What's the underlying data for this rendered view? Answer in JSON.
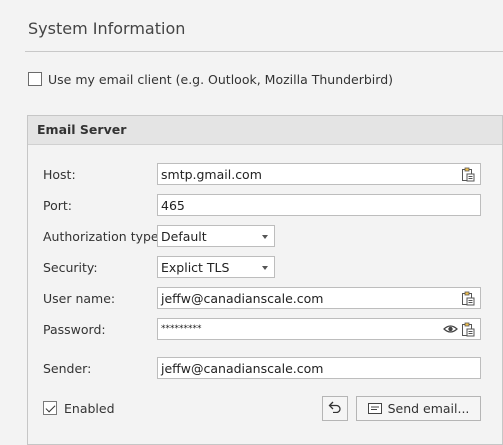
{
  "section_title": "System Information",
  "use_email_client": {
    "label": "Use my email client (e.g. Outlook, Mozilla Thunderbird)",
    "checked": false
  },
  "email_server": {
    "header": "Email Server",
    "host": {
      "label": "Host:",
      "value": "smtp.gmail.com",
      "icon": "clipboard-icon"
    },
    "port": {
      "label": "Port:",
      "value": "465"
    },
    "auth": {
      "label": "Authorization type:",
      "value": "Default"
    },
    "security": {
      "label": "Security:",
      "value": "Explict TLS"
    },
    "username": {
      "label": "User name:",
      "value": "jeffw@canadianscale.com",
      "icon": "clipboard-icon"
    },
    "password": {
      "label": "Password:",
      "value": "*********",
      "icons": [
        "eye-icon",
        "clipboard-icon"
      ]
    },
    "sender": {
      "label": "Sender:",
      "value": "jeffw@canadianscale.com"
    },
    "enabled": {
      "label": "Enabled",
      "checked": true
    },
    "undo_icon": "undo-icon",
    "send_email_label": "Send email...",
    "send_email_icon": "message-icon"
  }
}
